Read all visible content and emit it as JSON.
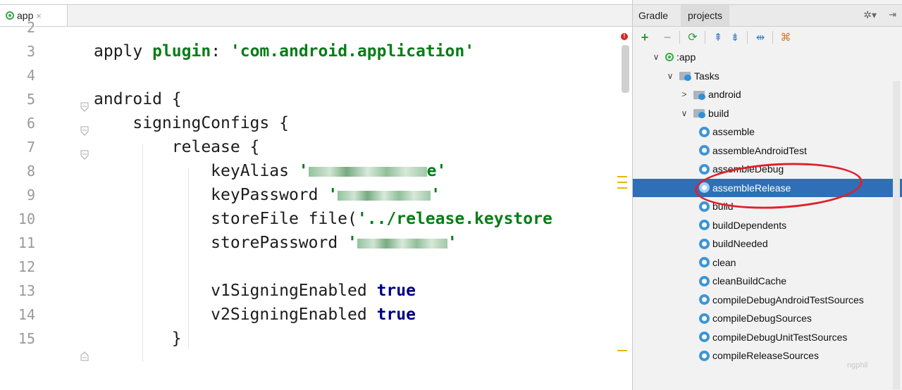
{
  "editor": {
    "tab": {
      "label": "app",
      "close": "×"
    },
    "lines": [
      {
        "num": "2",
        "html": ""
      },
      {
        "num": "3",
        "html": "apply <span class=\"plain-green\">plugin</span>: <span class=\"str\">'com.android.application'</span>"
      },
      {
        "num": "4",
        "html": ""
      },
      {
        "num": "5",
        "html": "android {"
      },
      {
        "num": "6",
        "html": "    signingConfigs {"
      },
      {
        "num": "7",
        "html": "        release {"
      },
      {
        "num": "8",
        "html": "            keyAlias <span class=\"str\">'</span><span class=\"blur\" style=\"width:168px\"></span><span class=\"str\">e'</span>"
      },
      {
        "num": "9",
        "html": "            keyPassword <span class=\"str\">'</span><span class=\"blur\" style=\"width:132px\"></span><span class=\"str\">'</span>"
      },
      {
        "num": "10",
        "html": "            storeFile file(<span class=\"str\">'../release.keystore</span>"
      },
      {
        "num": "11",
        "html": "            storePassword <span class=\"str\">'</span><span class=\"blur\" style=\"width:128px\"></span><span class=\"str\">'</span>"
      },
      {
        "num": "12",
        "html": ""
      },
      {
        "num": "13",
        "html": "            v1SigningEnabled <span class=\"kw\">true</span>"
      },
      {
        "num": "14",
        "html": "            v2SigningEnabled <span class=\"kw\">true</span>"
      },
      {
        "num": "15",
        "html": "        }"
      }
    ],
    "error_mark": "!"
  },
  "gradle": {
    "title": "Gradle",
    "tab": "projects",
    "settings_icon": "gear-icon",
    "toolbar": [
      "+",
      "−",
      "⟳",
      "⇞",
      "⇟",
      "⇹",
      "⌘"
    ],
    "tree": [
      {
        "label": ":app",
        "type": "project",
        "level": 0,
        "chevron": "∨"
      },
      {
        "label": "Tasks",
        "type": "folder",
        "level": 1,
        "chevron": "∨"
      },
      {
        "label": "android",
        "type": "folder",
        "level": 2,
        "chevron": ">"
      },
      {
        "label": "build",
        "type": "folder",
        "level": 2,
        "chevron": "∨"
      },
      {
        "label": "assemble",
        "type": "task",
        "level": 3
      },
      {
        "label": "assembleAndroidTest",
        "type": "task",
        "level": 3
      },
      {
        "label": "assembleDebug",
        "type": "task",
        "level": 3
      },
      {
        "label": "assembleRelease",
        "type": "task",
        "level": 3,
        "selected": true
      },
      {
        "label": "build",
        "type": "task",
        "level": 3
      },
      {
        "label": "buildDependents",
        "type": "task",
        "level": 3
      },
      {
        "label": "buildNeeded",
        "type": "task",
        "level": 3
      },
      {
        "label": "clean",
        "type": "task",
        "level": 3
      },
      {
        "label": "cleanBuildCache",
        "type": "task",
        "level": 3
      },
      {
        "label": "compileDebugAndroidTestSources",
        "type": "task",
        "level": 3
      },
      {
        "label": "compileDebugSources",
        "type": "task",
        "level": 3
      },
      {
        "label": "compileDebugUnitTestSources",
        "type": "task",
        "level": 3
      },
      {
        "label": "compileReleaseSources",
        "type": "task",
        "level": 3
      }
    ],
    "watermark": "ngphil"
  },
  "colors": {
    "selection": "#2f6fb8",
    "string": "#067d17",
    "keyword": "#000080",
    "highlight": "#e0202a"
  }
}
